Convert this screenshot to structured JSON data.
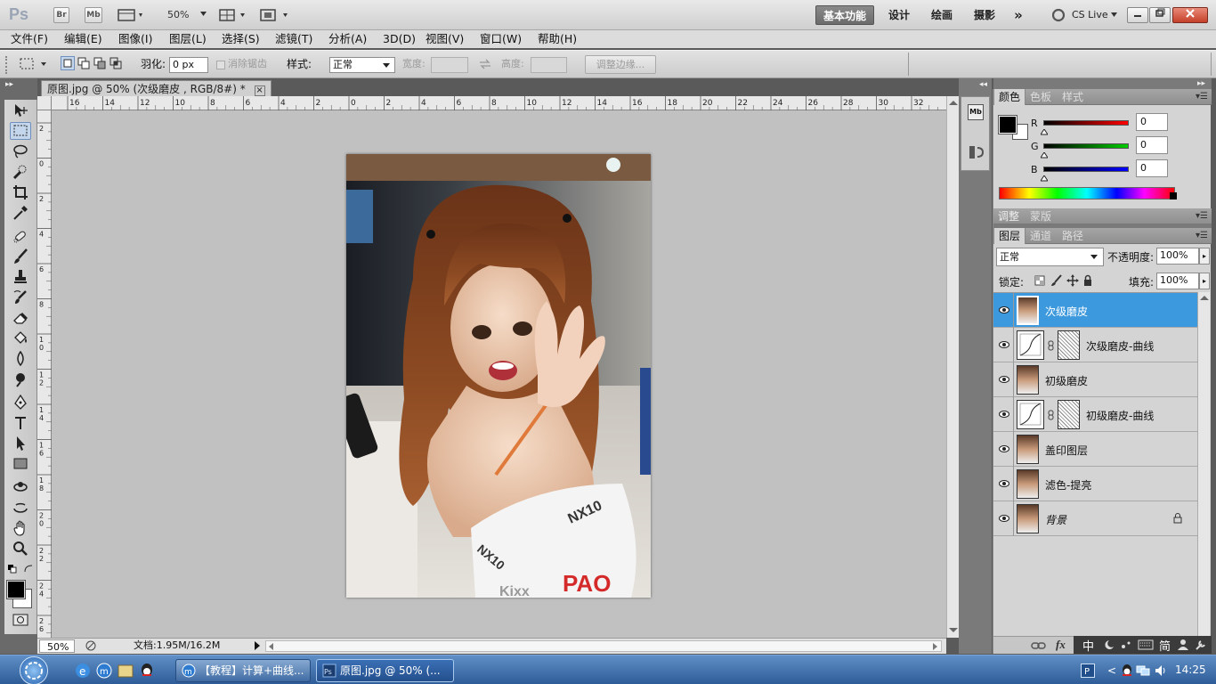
{
  "app": {
    "logo": "Ps",
    "bridge": "Br",
    "minibridge": "Mb",
    "zoom": "50%",
    "workspaces": [
      "基本功能",
      "设计",
      "绘画",
      "摄影"
    ],
    "more": "»",
    "cslive": "CS Live",
    "colors": {
      "accent": "#3d99dd",
      "taskbar": "#2e5c98"
    }
  },
  "menu": [
    "文件(F)",
    "编辑(E)",
    "图像(I)",
    "图层(L)",
    "选择(S)",
    "滤镜(T)",
    "分析(A)",
    "3D(D)",
    "视图(V)",
    "窗口(W)",
    "帮助(H)"
  ],
  "options": {
    "feather_label": "羽化:",
    "feather_value": "0 px",
    "antialias_label": "消除锯齿",
    "style_label": "样式:",
    "style_value": "正常",
    "width_label": "宽度:",
    "height_label": "高度:",
    "refine_edge": "调整边缘..."
  },
  "document": {
    "tab_title": "原图.jpg @ 50% (次级磨皮 , RGB/8#) *",
    "close": "×",
    "ruler_h": [
      "16",
      "14",
      "12",
      "10",
      "8",
      "6",
      "4",
      "2",
      "0",
      "2",
      "4",
      "6",
      "8",
      "10",
      "12",
      "14",
      "16",
      "18",
      "20",
      "22",
      "24",
      "26",
      "28",
      "30",
      "32"
    ],
    "ruler_v": [
      "2",
      "0",
      "2",
      "4",
      "6",
      "8",
      "1\n0",
      "1\n2",
      "1\n4",
      "1\n6",
      "1\n8",
      "2\n0",
      "2\n2",
      "2\n4",
      "2\n6"
    ],
    "status_zoom": "50%",
    "status_doc": "文档:1.95M/16.2M",
    "photo_text": [
      "NX10",
      "NX10",
      "PAO",
      "Kixx"
    ]
  },
  "color_panel": {
    "tabs": [
      "颜色",
      "色板",
      "样式"
    ],
    "channels": [
      {
        "label": "R",
        "value": "0"
      },
      {
        "label": "G",
        "value": "0"
      },
      {
        "label": "B",
        "value": "0"
      }
    ]
  },
  "adjust_panel": {
    "tabs": [
      "调整",
      "蒙版"
    ]
  },
  "layers_panel": {
    "tabs": [
      "图层",
      "通道",
      "路径"
    ],
    "blend_mode": "正常",
    "opacity_label": "不透明度:",
    "opacity_value": "100%",
    "lock_label": "锁定:",
    "fill_label": "填充:",
    "fill_value": "100%",
    "layers": [
      {
        "name": "次级磨皮",
        "selected": true
      },
      {
        "name": "次级磨皮-曲线",
        "curve": true
      },
      {
        "name": "初级磨皮"
      },
      {
        "name": "初级磨皮-曲线",
        "curve": true
      },
      {
        "name": "盖印图层"
      },
      {
        "name": "滤色-提亮"
      },
      {
        "name": "背景",
        "locked": true
      }
    ],
    "bottom_ime": [
      "中",
      "简"
    ]
  },
  "taskbar": {
    "tasks": [
      "【教程】计算+曲线...",
      "原图.jpg @ 50% (..."
    ],
    "clock": "14:25"
  }
}
